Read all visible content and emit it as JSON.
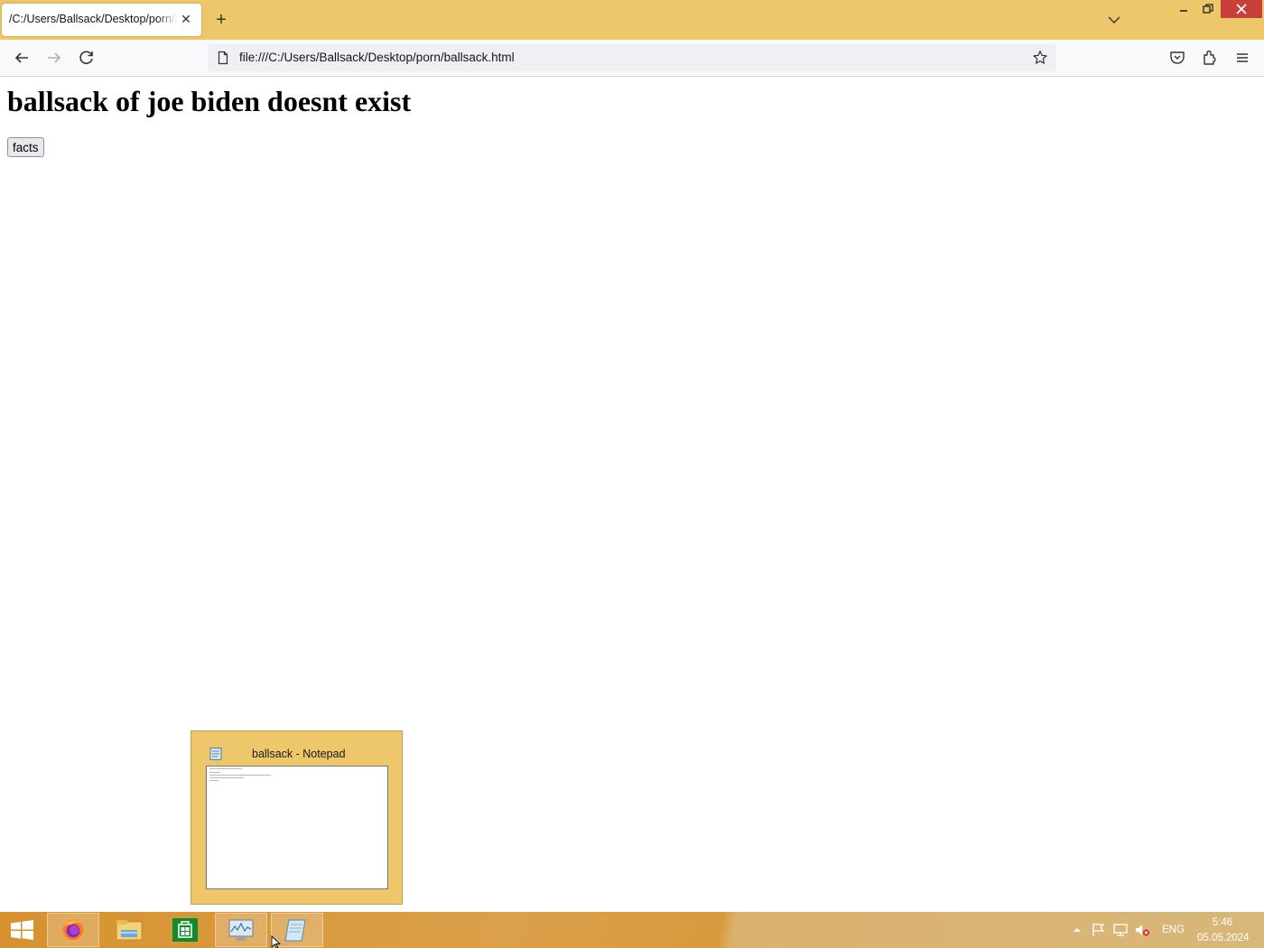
{
  "browser": {
    "tab_title": "/C:/Users/Ballsack/Desktop/porn/ballsack.html",
    "url": "file:///C:/Users/Ballsack/Desktop/porn/ballsack.html",
    "theme_color": "#eec76b"
  },
  "page": {
    "heading": "ballsack of joe biden doesnt exist",
    "button_label": "facts"
  },
  "taskbar": {
    "items": [
      "firefox-icon",
      "file-explorer-icon",
      "store-icon",
      "resource-monitor-icon",
      "notepad-icon"
    ],
    "language": "ENG",
    "time": "5:46",
    "date": "05.05.2024"
  },
  "thumbnail": {
    "title": "ballsack - Notepad"
  }
}
